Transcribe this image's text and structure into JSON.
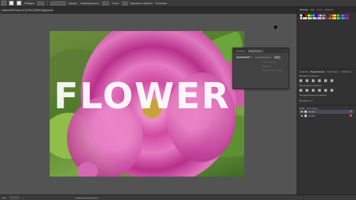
{
  "topbar": {
    "stroke_label": "Обводка:",
    "opacity_label": "Непрозрачность:",
    "opacity_value": "100%",
    "style_label": "Стиль:",
    "align_label": "Выровнять объекты",
    "transform_label": "Установки",
    "shape_label": "Окружн.",
    "icons": [
      "selection-tool-icon",
      "fill-swatch",
      "stroke-swatch",
      "brush-dropdown"
    ]
  },
  "document": {
    "tab_title": "спасенный Flower.ai* @ 50% (RGB/Предпросмотр GPU)",
    "close_glyph": "×"
  },
  "canvas": {
    "headline_text": "FLOWER"
  },
  "float_panel": {
    "tabs": [
      "Образцы",
      "Прозрачность"
    ],
    "active_tab": "Прозрачность",
    "blend_mode": "Нормальный",
    "opacity_label": "Непрозрачность:",
    "opacity_value": "100%",
    "option_1": "Создать маску",
    "option_2": "Обрезать",
    "option_3": "Инвертировать маску"
  },
  "right_dock": {
    "top_tabs": [
      "Образцы",
      "Цвет",
      "Кисти",
      "Символы"
    ],
    "active_top_tab": "Образцы",
    "mid_tabs": [
      "Свойства",
      "Выравнивание",
      "Трансформ.",
      "Обработка"
    ],
    "active_mid_tab": "Выравнивание",
    "align_objects_label": "Выровнять объекты:",
    "distribute_objects_label": "Распределить объекты:",
    "distribute_spacing_label": "Распределение интервалов:",
    "align_to_label": "Выровнять по:",
    "layers_tabs": [
      "Слои",
      "Монтажные"
    ],
    "active_layers_tab": "Слои",
    "layers": [
      {
        "name": "Слой 1",
        "color": "#4f6fff"
      },
      {
        "name": "Слой 2",
        "color": "#ff4f4f"
      }
    ],
    "swatch_colors": [
      "#ffffff",
      "#000000",
      "#ff0000",
      "#ffff00",
      "#00ff00",
      "#00ffff",
      "#0000ff",
      "#ff00ff",
      "#c8c8c8",
      "#969696",
      "#646464",
      "#323232",
      "#e6282d",
      "#f5a623",
      "#f8e71c",
      "#7ed321",
      "#417505",
      "#4a90e2",
      "#9013fe",
      "#bd10e0",
      "#ffd7d7",
      "#ffe0b2",
      "#fff9c4",
      "#dcedc8",
      "#b2dfdb",
      "#b3e5fc",
      "#c5cae9",
      "#e1bee7",
      "#f8bbd0",
      "#d7ccc8",
      "#8d6e63",
      "#6d4c41",
      "#ff7043",
      "#ffa726",
      "#ffee58",
      "#9ccc65",
      "#26a69a",
      "#29b6f6",
      "#5c6bc0",
      "#ab47bc"
    ]
  },
  "statusbar": {
    "zoom": "50%",
    "page": "1",
    "tool_name": "Выделенный фрагмент"
  }
}
